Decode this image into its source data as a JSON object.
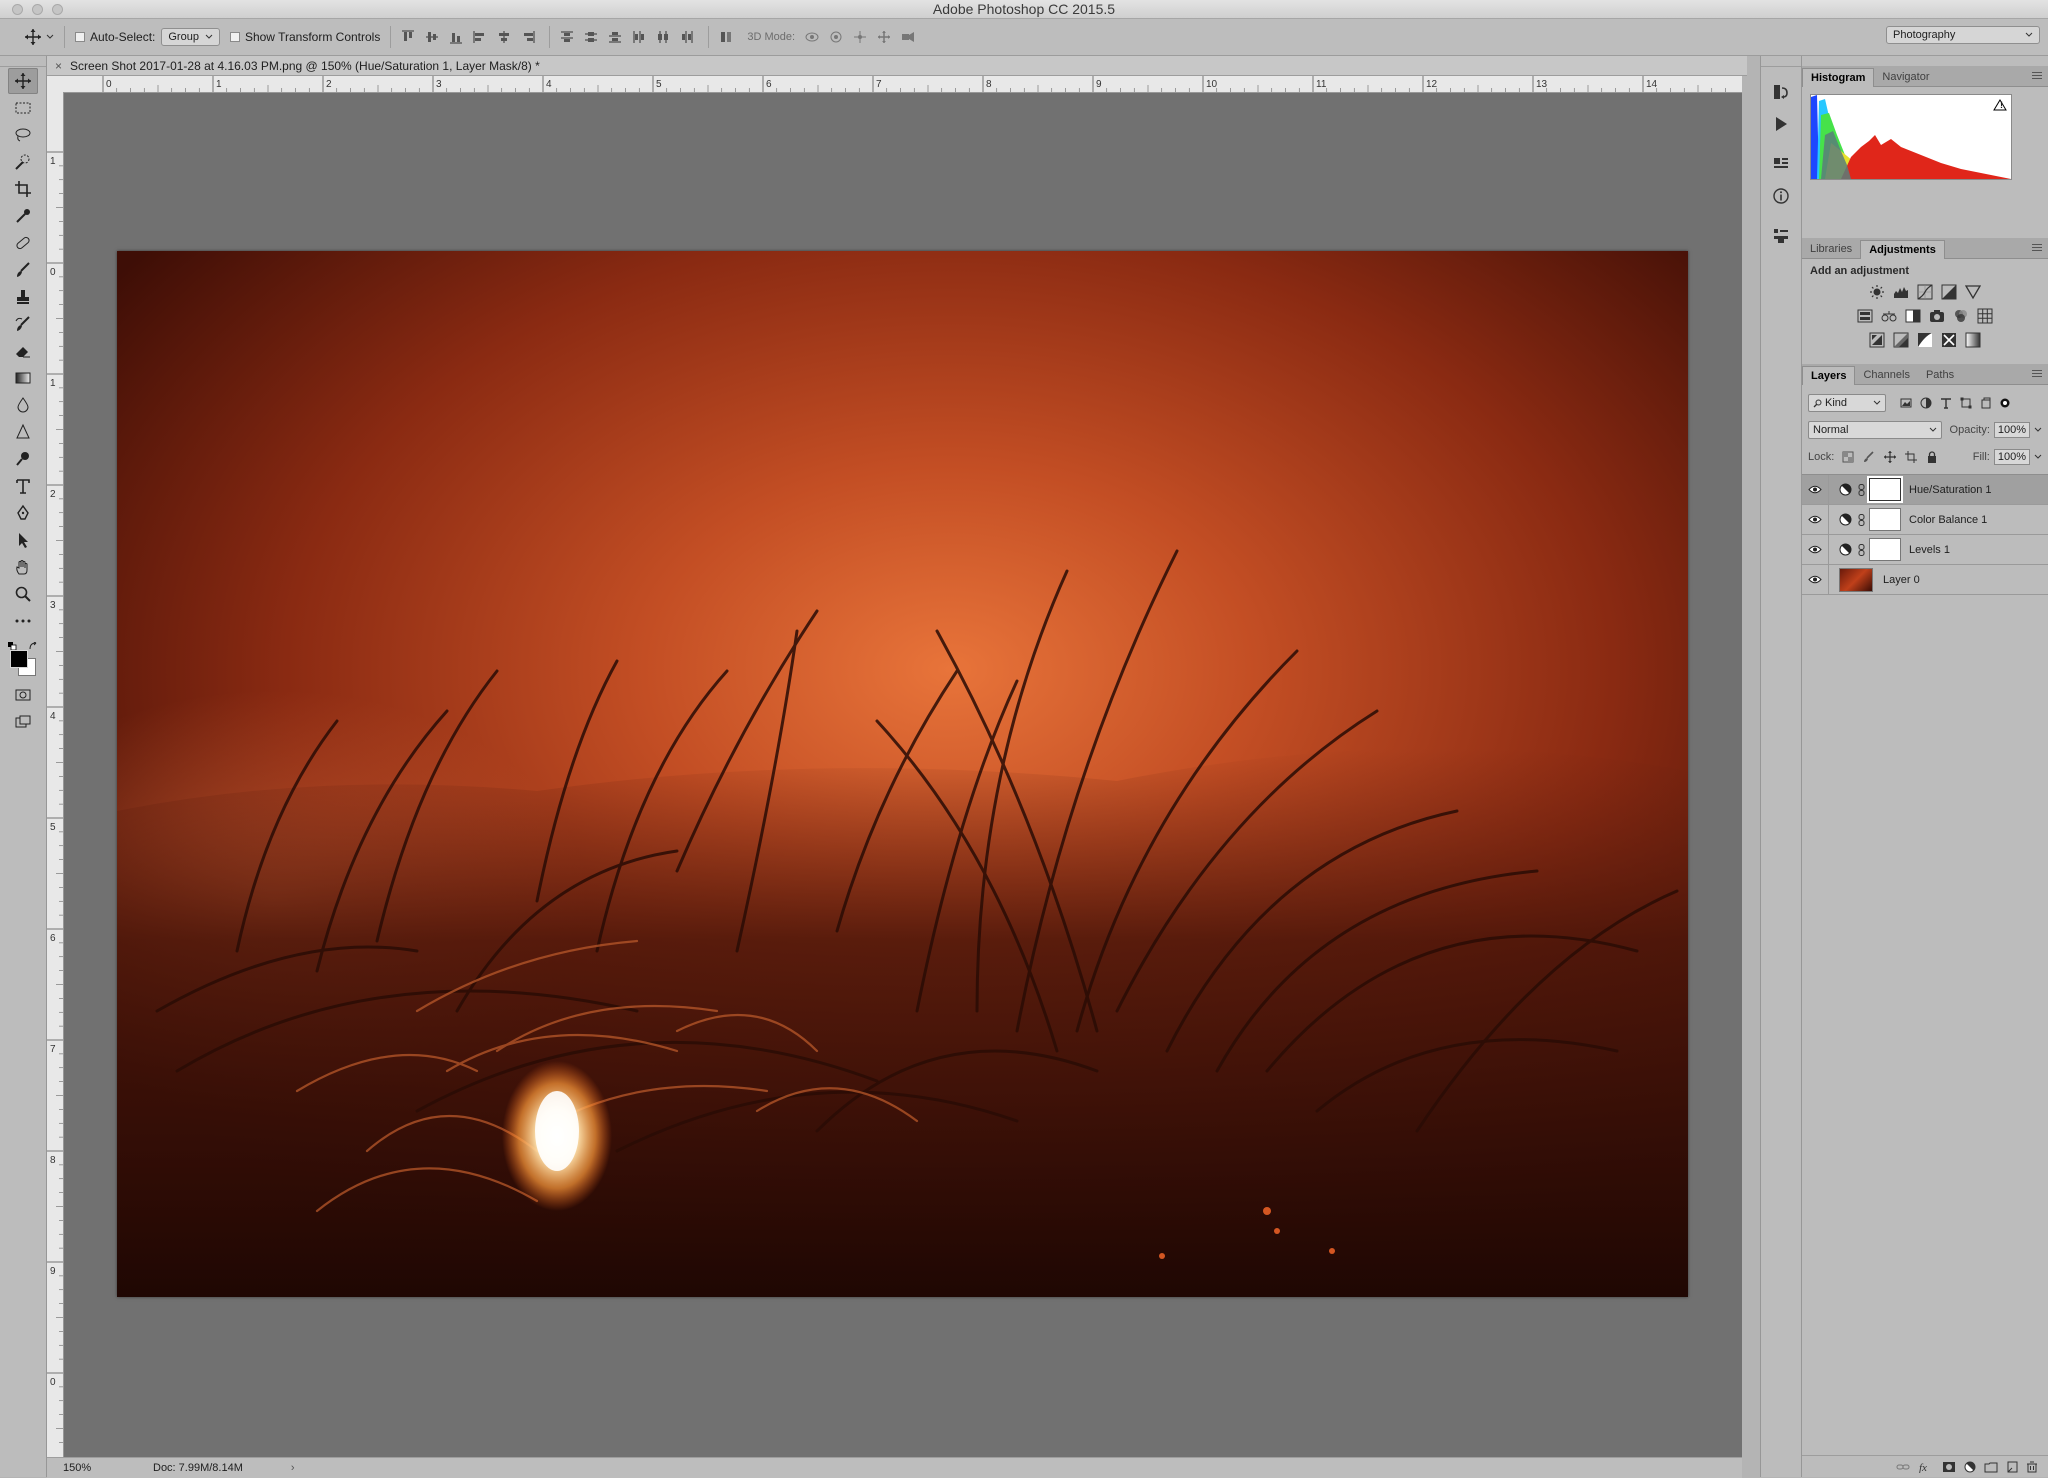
{
  "window": {
    "title": "Adobe Photoshop CC 2015.5"
  },
  "options_bar": {
    "auto_select_label": "Auto-Select:",
    "auto_select_value": "Group",
    "show_transform_label": "Show Transform Controls",
    "mode_3d_label": "3D Mode:",
    "workspace": "Photography"
  },
  "document": {
    "tab_title": "Screen Shot 2017-01-28 at 4.16.03 PM.png @ 150% (Hue/Saturation 1, Layer Mask/8) *",
    "close_glyph": "×",
    "ruler_top_ticks": [
      "0",
      "1",
      "2",
      "3",
      "4",
      "5",
      "6",
      "7",
      "8",
      "9",
      "10",
      "11",
      "12",
      "13",
      "14"
    ],
    "ruler_left_ticks": [
      "1",
      "0",
      "1",
      "2",
      "3",
      "4",
      "5",
      "6",
      "7",
      "8",
      "9",
      "0"
    ]
  },
  "status_bar": {
    "zoom": "150%",
    "doc_info": "Doc: 7.99M/8.14M",
    "arrow": "›"
  },
  "histogram_panel": {
    "tabs": [
      "Histogram",
      "Navigator"
    ],
    "active_tab": 0,
    "warning_glyph": "!"
  },
  "adjustments_panel": {
    "tabs": [
      "Libraries",
      "Adjustments"
    ],
    "active_tab": 1,
    "heading": "Add an adjustment"
  },
  "layers_panel": {
    "tabs": [
      "Layers",
      "Channels",
      "Paths"
    ],
    "active_tab": 0,
    "filter_kind": "Kind",
    "blend_mode": "Normal",
    "opacity_label": "Opacity:",
    "opacity_value": "100%",
    "lock_label": "Lock:",
    "fill_label": "Fill:",
    "fill_value": "100%",
    "layers": [
      {
        "name": "Hue/Saturation 1",
        "type": "adjustment",
        "selected": true
      },
      {
        "name": "Color Balance 1",
        "type": "adjustment",
        "selected": false
      },
      {
        "name": "Levels 1",
        "type": "adjustment",
        "selected": false
      },
      {
        "name": "Layer 0",
        "type": "image",
        "selected": false
      }
    ]
  },
  "colors": {
    "foreground": "#000000",
    "background": "#ffffff"
  }
}
